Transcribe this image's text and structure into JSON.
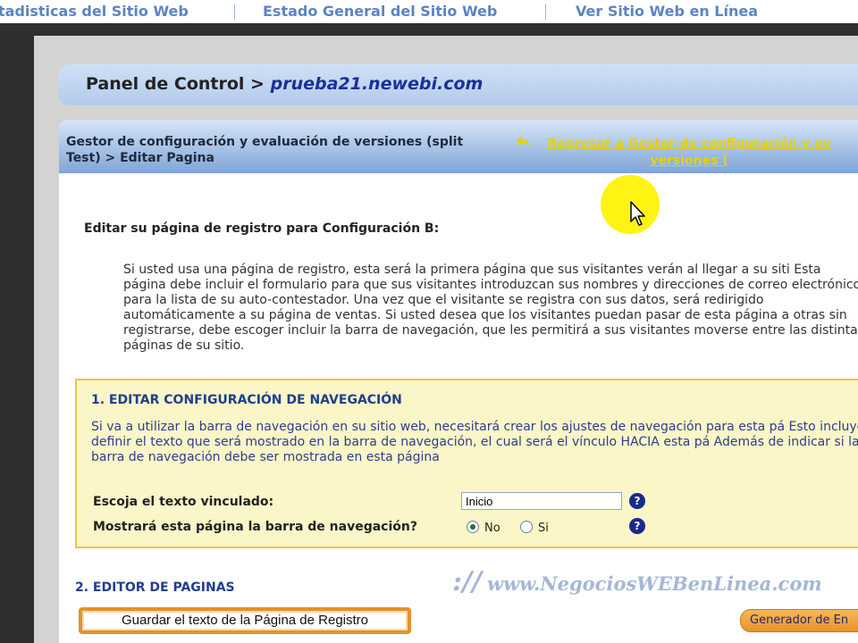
{
  "topnav": {
    "tabs": [
      {
        "label": "tadisticas del Sitio Web"
      },
      {
        "label": "Estado General del Sitio Web"
      },
      {
        "label": "Ver Sitio Web en Línea"
      }
    ]
  },
  "breadcrumb": {
    "prefix": "Panel de Control >",
    "site": "prueba21.newebi.com"
  },
  "header": {
    "title": "Gestor de configuración y evaluación de versiones (split Test) > Editar Pagina",
    "back_link": "Regresar a Gestor de configuración y ev versiones (",
    "link_color": "#e6d200"
  },
  "page_heading": "Editar su página de registro para Configuración B:",
  "intro_text": "Si usted usa una página de registro, esta será la primera página que sus visitantes verán al llegar a su siti Esta página debe incluir el formulario para que sus visitantes introduzcan sus nombres y direcciones de correo electrónico para la lista de su auto-contestador. Una vez que el visitante se registra con sus datos, será redirigido automáticamente a su página de ventas. Si usted desea que los visitantes puedan pasar de esta página a otras sin registrarse, debe escoger incluir la barra de navegación, que les permitirá a sus visitantes moverse entre las distintas páginas de su sitio.",
  "nav_section": {
    "title": "1. EDITAR CONFIGURACIÓN DE NAVEGACIÓN",
    "text": "Si va a utilizar la barra de navegación en su sitio web, necesitará crear los ajustes de navegación para esta pá Esto incluye definir el texto que será mostrado en la barra de navegación, el cual será el vínculo HACIA esta pá Además de indicar si la barra de navegación debe ser mostrada en esta página",
    "link_text_label": "Escoja el texto vinculado:",
    "link_text_value": "Inicio",
    "show_nav_label": "Mostrará esta página la barra de navegación?",
    "options": [
      {
        "label": "No",
        "selected": true
      },
      {
        "label": "Si",
        "selected": false
      }
    ],
    "help_glyph": "?"
  },
  "editor_section": {
    "title": "2. EDITOR DE PAGINAS"
  },
  "watermark": {
    "slashes": "://",
    "text": "www.NegociosWEBenLinea.com"
  },
  "buttons": {
    "save_label": "Guardar el texto de la Página de Registro",
    "generator_label": "Generador de En"
  },
  "colors": {
    "accent_blue": "#1f3f8f",
    "box_background": "#fbf6c8",
    "button_orange": "#e8922a",
    "cursor_highlight": "#fff200"
  }
}
